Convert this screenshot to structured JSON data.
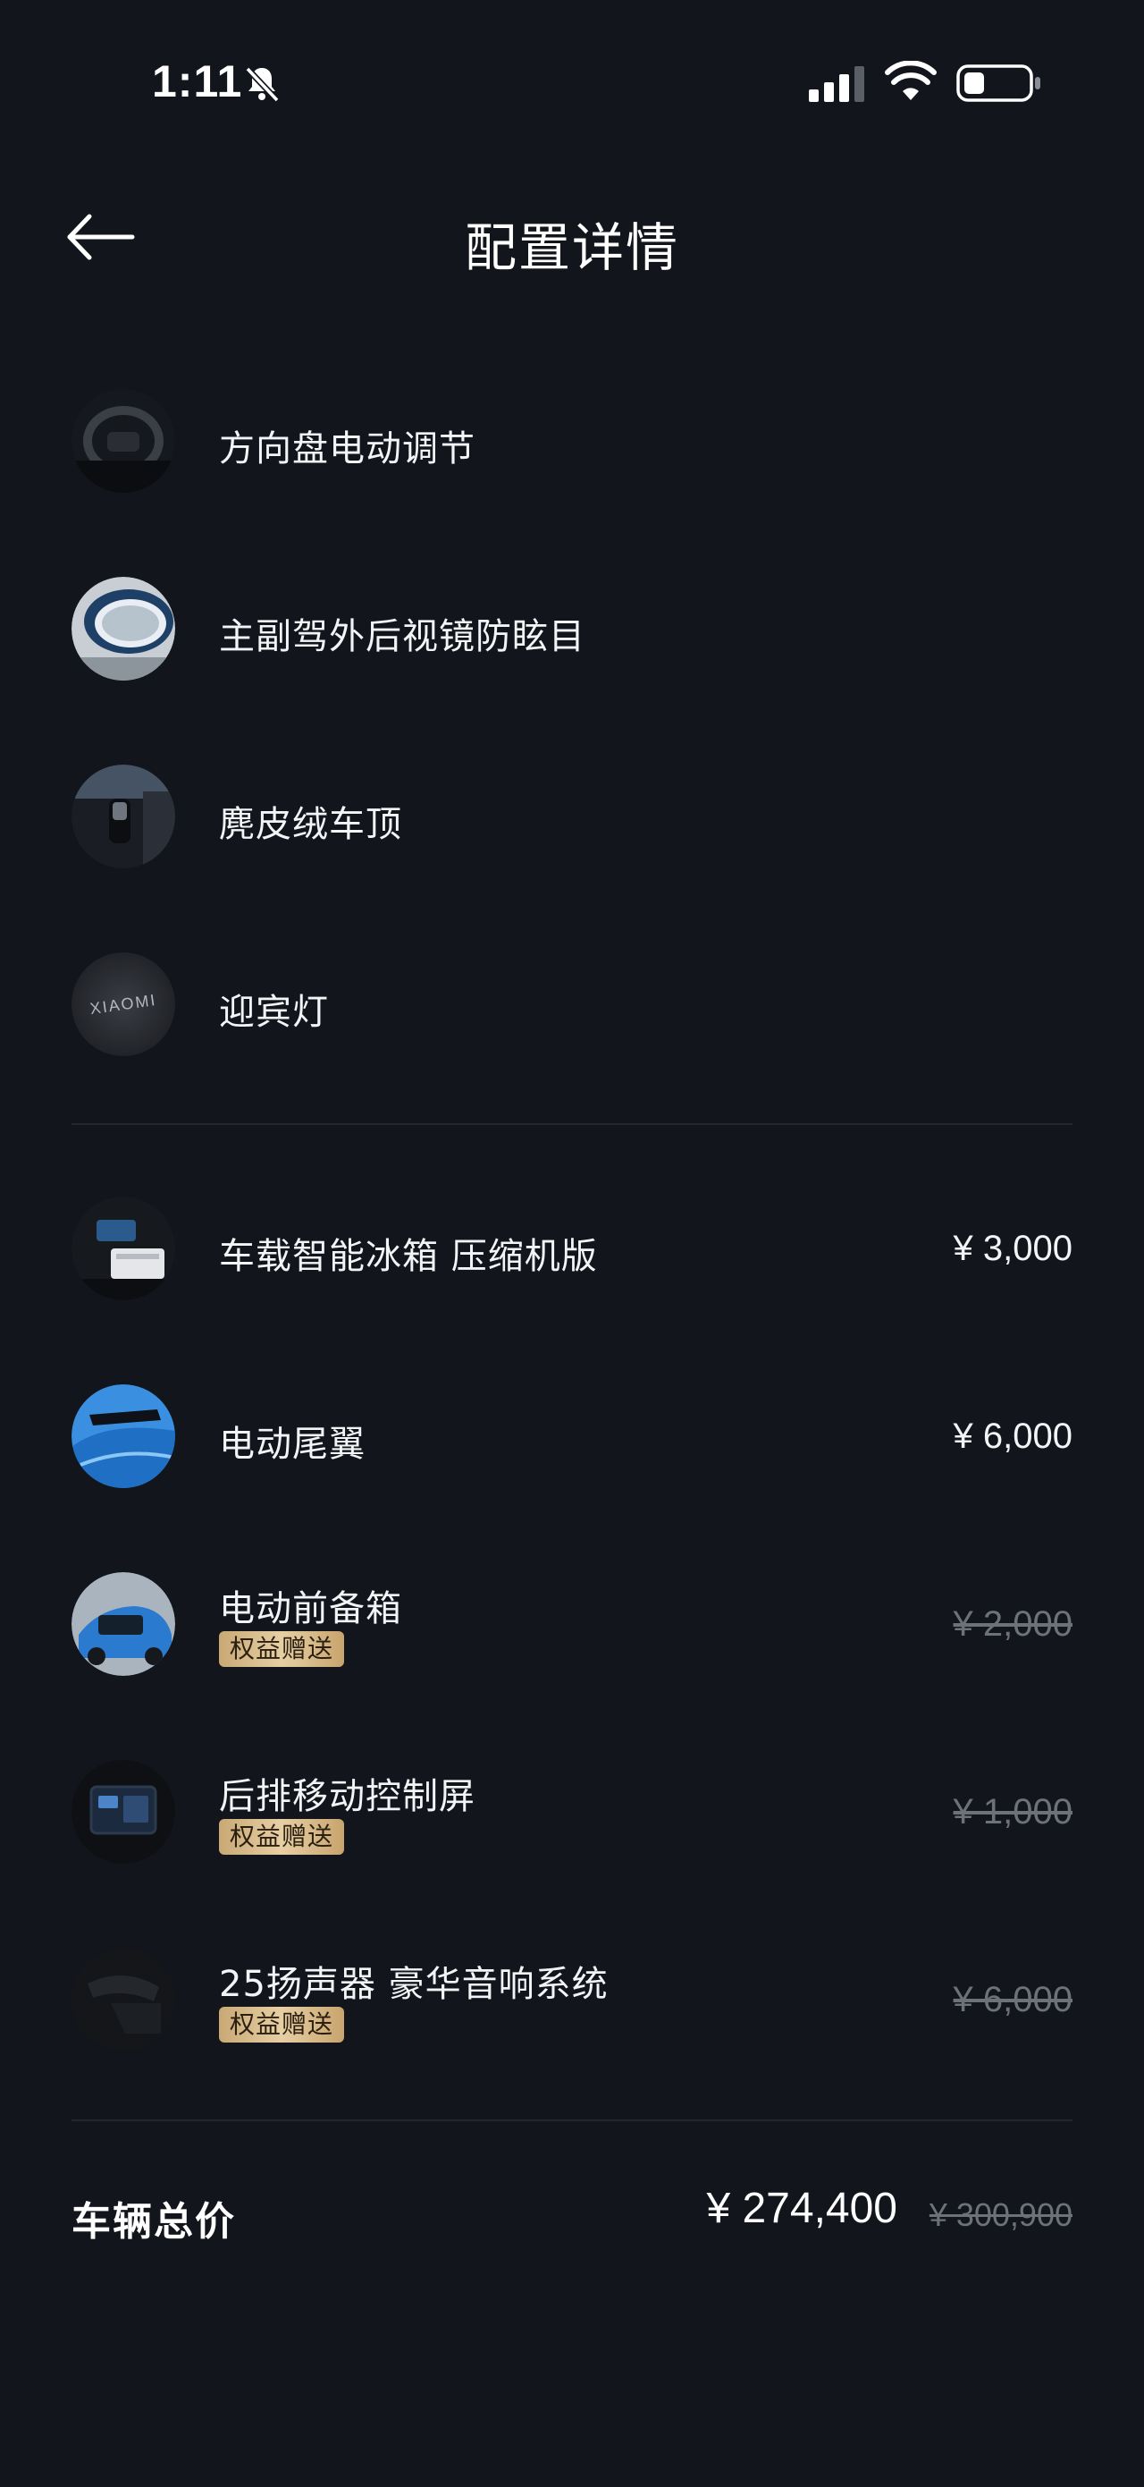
{
  "status_bar": {
    "time": "1:11",
    "icons": [
      "bell-off-icon",
      "signal-icon",
      "wifi-icon",
      "battery-icon"
    ]
  },
  "header": {
    "title": "配置详情",
    "back_icon": "arrow-left-icon"
  },
  "standard_items": [
    {
      "label": "方向盘电动调节",
      "icon": "steering-wheel"
    },
    {
      "label": "主副驾外后视镜防眩目",
      "icon": "side-mirror"
    },
    {
      "label": "麂皮绒车顶",
      "icon": "suede-roof"
    },
    {
      "label": "迎宾灯",
      "icon": "welcome-light",
      "logo_text": "XIAOMI"
    }
  ],
  "option_items": [
    {
      "label": "车载智能冰箱 压缩机版",
      "price": "¥ 3,000",
      "struck": false
    },
    {
      "label": "电动尾翼",
      "price": "¥ 6,000",
      "struck": false
    },
    {
      "label": "电动前备箱",
      "badge": "权益赠送",
      "price": "¥ 2,000",
      "struck": true
    },
    {
      "label": "后排移动控制屏",
      "badge": "权益赠送",
      "price": "¥ 1,000",
      "struck": true
    },
    {
      "label": "25扬声器 豪华音响系统",
      "badge": "权益赠送",
      "price": "¥ 6,000",
      "struck": true
    }
  ],
  "total": {
    "label": "车辆总价",
    "price": "¥ 274,400",
    "original_price": "¥ 300,900"
  },
  "colors": {
    "background": "#12151c",
    "text": "#ffffff",
    "muted": "#6d7178",
    "badge_gold": "#d9bc88",
    "accent_blue": "#2f8fe0"
  }
}
